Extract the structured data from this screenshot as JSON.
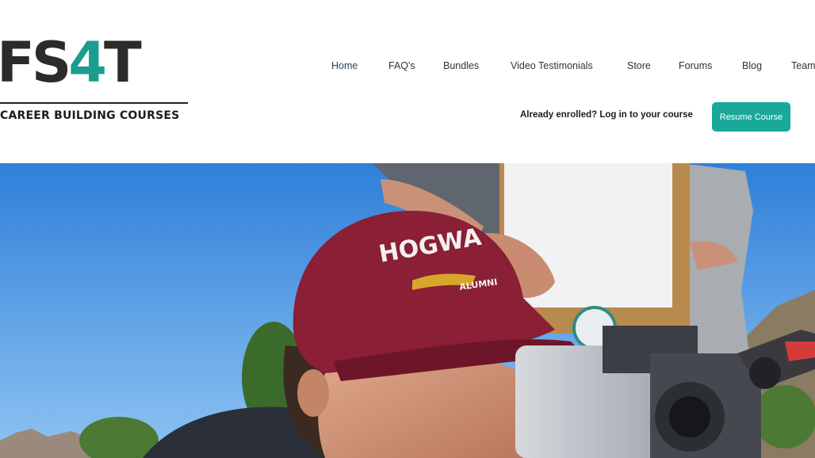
{
  "logo": {
    "mark_left": "FS",
    "mark_four": "4",
    "mark_right": "T",
    "tagline": "CAREER BUILDING COURSES"
  },
  "nav": {
    "items": [
      {
        "label": "Home",
        "active": true
      },
      {
        "label": "FAQ's"
      },
      {
        "label": "Bundles"
      },
      {
        "label": "Video Testimonials"
      },
      {
        "label": "Store"
      },
      {
        "label": "Forums"
      },
      {
        "label": "Blog"
      },
      {
        "label": "Team"
      }
    ]
  },
  "login": {
    "prompt": "Already enrolled? Log in to your course",
    "button_label": "Resume Course"
  },
  "hero": {
    "cap_text": "HOGWA",
    "cap_subtext": "ALUMNI"
  },
  "colors": {
    "brand_teal": "#1aa89a",
    "cap_maroon": "#8a1f35",
    "sky": "#3f8fe0"
  }
}
